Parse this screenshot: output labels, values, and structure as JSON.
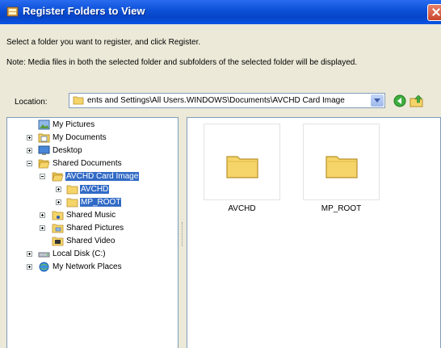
{
  "window": {
    "title": "Register Folders to View"
  },
  "instructions": {
    "line1": "Select a folder you want to register, and click Register.",
    "line2": "Note: Media files in both the selected folder and subfolders of the selected folder will be displayed."
  },
  "location": {
    "label": "Location:",
    "value": "ents and Settings\\All Users.WINDOWS\\Documents\\AVCHD Card Image"
  },
  "tree": {
    "items": [
      {
        "label": "My Pictures",
        "icon": "my-pictures-icon"
      },
      {
        "label": "My Documents",
        "icon": "my-documents-icon"
      },
      {
        "label": "Desktop",
        "icon": "desktop-icon"
      },
      {
        "label": "Shared Documents",
        "icon": "folder-open-icon"
      },
      {
        "label": "AVCHD Card Image",
        "icon": "folder-open-icon",
        "selected": true
      },
      {
        "label": "AVCHD",
        "icon": "folder-icon",
        "selected": true
      },
      {
        "label": "MP_ROOT",
        "icon": "folder-icon",
        "selected": true
      },
      {
        "label": "Shared Music",
        "icon": "shared-music-icon"
      },
      {
        "label": "Shared Pictures",
        "icon": "shared-pictures-icon"
      },
      {
        "label": "Shared Video",
        "icon": "shared-video-icon"
      },
      {
        "label": "Local Disk (C:)",
        "icon": "local-disk-icon"
      },
      {
        "label": "My Network Places",
        "icon": "network-places-icon"
      }
    ]
  },
  "files": [
    {
      "label": "AVCHD",
      "icon": "folder-icon"
    },
    {
      "label": "MP_ROOT",
      "icon": "folder-icon"
    }
  ],
  "colors": {
    "title_bar": "#0a54e4",
    "selection": "#316ac5",
    "folder": "#f5d56a"
  }
}
